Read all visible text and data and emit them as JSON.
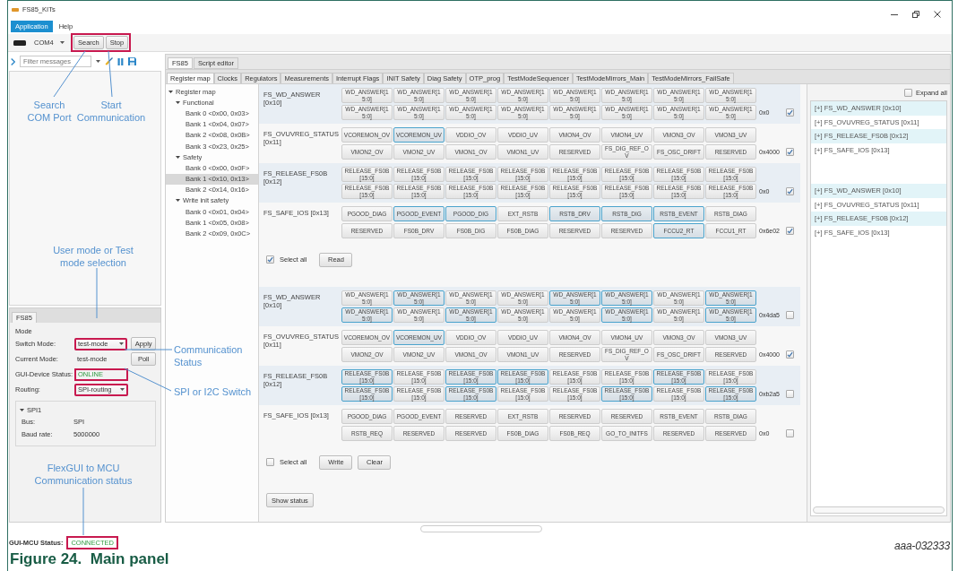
{
  "window": {
    "title": "FS85_KITs"
  },
  "menu": [
    {
      "label": "Application",
      "selected": true
    },
    {
      "label": "Help",
      "selected": false
    }
  ],
  "toolbar": {
    "port": "COM4",
    "buttons": [
      "Search",
      "Stop"
    ],
    "marked": true
  },
  "log_panel": {
    "filter_placeholder": "Filter messages"
  },
  "device_panel": {
    "tab": "FS85",
    "section": "Mode",
    "fields": [
      {
        "kind": "dropdown",
        "label": "Switch Mode:",
        "value": "test-mode",
        "button": "Apply",
        "marked": true
      },
      {
        "kind": "text",
        "label": "Current Mode:",
        "value": "test-mode",
        "button": "Poll",
        "marked": false
      },
      {
        "kind": "status",
        "label": "GUI-Device Status:",
        "value": "ONLINE",
        "marked": true
      },
      {
        "kind": "dropdown",
        "label": "Routing:",
        "value": "SPI-routing",
        "marked": true
      }
    ],
    "bus_group": {
      "title": "SPI1",
      "expanded": true,
      "rows": [
        {
          "label": "Bus:",
          "value": "SPI"
        },
        {
          "label": "Baud rate:",
          "value": "5000000"
        }
      ]
    }
  },
  "main_tabs": [
    {
      "label": "FS85",
      "selected": true
    },
    {
      "label": "Script editor",
      "selected": false
    }
  ],
  "sub_tabs": [
    {
      "label": "Register map",
      "selected": true
    },
    {
      "label": "Clocks",
      "selected": false
    },
    {
      "label": "Regulators",
      "selected": false
    },
    {
      "label": "Measurements",
      "selected": false
    },
    {
      "label": "Interrupt Flags",
      "selected": false
    },
    {
      "label": "INIT Safety",
      "selected": false
    },
    {
      "label": "Diag Safety",
      "selected": false
    },
    {
      "label": "OTP_prog",
      "selected": false
    },
    {
      "label": "TestModeSequencer",
      "selected": false
    },
    {
      "label": "TestModeMirrors_Main",
      "selected": false
    },
    {
      "label": "TestModeMirrors_FailSafe",
      "selected": false
    }
  ],
  "tree": {
    "label": "Register map",
    "expanded": true,
    "selected": false,
    "children": [
      {
        "label": "Functional",
        "expanded": true,
        "selected": false,
        "children": [
          {
            "label": "Bank 0 <0x00, 0x03>",
            "selected": false
          },
          {
            "label": "Bank 1 <0x04, 0x07>",
            "selected": false
          },
          {
            "label": "Bank 2 <0x08, 0x0B>",
            "selected": false
          },
          {
            "label": "Bank 3 <0x23, 0x25>",
            "selected": false
          }
        ]
      },
      {
        "label": "Safety",
        "expanded": true,
        "selected": false,
        "children": [
          {
            "label": "Bank 0 <0x00, 0x0F>",
            "selected": false
          },
          {
            "label": "Bank 1 <0x10, 0x13>",
            "selected": true
          },
          {
            "label": "Bank 2 <0x14, 0x16>",
            "selected": false
          }
        ]
      },
      {
        "label": "Write init safety",
        "expanded": true,
        "selected": false,
        "children": [
          {
            "label": "Bank 0 <0x01, 0x04>",
            "selected": false
          },
          {
            "label": "Bank 1 <0x05, 0x08>",
            "selected": false
          },
          {
            "label": "Bank 2 <0x09, 0x0C>",
            "selected": false
          }
        ]
      }
    ]
  },
  "read_panel": {
    "registers": [
      {
        "name": "FS_WD_ANSWER [0x10]",
        "value": "0x0",
        "checked": true,
        "bits": [
          [
            {
              "label": "WD_ANSWER[15:0]",
              "set": false
            },
            {
              "label": "WD_ANSWER[15:0]",
              "set": false
            },
            {
              "label": "WD_ANSWER[15:0]",
              "set": false
            },
            {
              "label": "WD_ANSWER[15:0]",
              "set": false
            },
            {
              "label": "WD_ANSWER[15:0]",
              "set": false
            },
            {
              "label": "WD_ANSWER[15:0]",
              "set": false
            },
            {
              "label": "WD_ANSWER[15:0]",
              "set": false
            },
            {
              "label": "WD_ANSWER[15:0]",
              "set": false
            }
          ],
          [
            {
              "label": "WD_ANSWER[15:0]",
              "set": false
            },
            {
              "label": "WD_ANSWER[15:0]",
              "set": false
            },
            {
              "label": "WD_ANSWER[15:0]",
              "set": false
            },
            {
              "label": "WD_ANSWER[15:0]",
              "set": false
            },
            {
              "label": "WD_ANSWER[15:0]",
              "set": false
            },
            {
              "label": "WD_ANSWER[15:0]",
              "set": false
            },
            {
              "label": "WD_ANSWER[15:0]",
              "set": false
            },
            {
              "label": "WD_ANSWER[15:0]",
              "set": false
            }
          ]
        ]
      },
      {
        "name": "FS_OVUVREG_STATUS [0x11]",
        "value": "0x4000",
        "checked": true,
        "bits": [
          [
            {
              "label": "VCOREMON_OV",
              "set": false
            },
            {
              "label": "VCOREMON_UV",
              "set": true
            },
            {
              "label": "VDDIO_OV",
              "set": false
            },
            {
              "label": "VDDIO_UV",
              "set": false
            },
            {
              "label": "VMON4_OV",
              "set": false
            },
            {
              "label": "VMON4_UV",
              "set": false
            },
            {
              "label": "VMON3_OV",
              "set": false
            },
            {
              "label": "VMON3_UV",
              "set": false
            }
          ],
          [
            {
              "label": "VMON2_OV",
              "set": false
            },
            {
              "label": "VMON2_UV",
              "set": false
            },
            {
              "label": "VMON1_OV",
              "set": false
            },
            {
              "label": "VMON1_UV",
              "set": false
            },
            {
              "label": "RESERVED",
              "set": false
            },
            {
              "label": "FS_DIG_REF_OV",
              "set": false
            },
            {
              "label": "FS_OSC_DRIFT",
              "set": false
            },
            {
              "label": "RESERVED",
              "set": false
            }
          ]
        ]
      },
      {
        "name": "FS_RELEASE_FS0B [0x12]",
        "value": "0x0",
        "checked": true,
        "bits": [
          [
            {
              "label": "RELEASE_FS0B[15:0]",
              "set": false
            },
            {
              "label": "RELEASE_FS0B[15:0]",
              "set": false
            },
            {
              "label": "RELEASE_FS0B[15:0]",
              "set": false
            },
            {
              "label": "RELEASE_FS0B[15:0]",
              "set": false
            },
            {
              "label": "RELEASE_FS0B[15:0]",
              "set": false
            },
            {
              "label": "RELEASE_FS0B[15:0]",
              "set": false
            },
            {
              "label": "RELEASE_FS0B[15:0]",
              "set": false
            },
            {
              "label": "RELEASE_FS0B[15:0]",
              "set": false
            }
          ],
          [
            {
              "label": "RELEASE_FS0B[15:0]",
              "set": false
            },
            {
              "label": "RELEASE_FS0B[15:0]",
              "set": false
            },
            {
              "label": "RELEASE_FS0B[15:0]",
              "set": false
            },
            {
              "label": "RELEASE_FS0B[15:0]",
              "set": false
            },
            {
              "label": "RELEASE_FS0B[15:0]",
              "set": false
            },
            {
              "label": "RELEASE_FS0B[15:0]",
              "set": false
            },
            {
              "label": "RELEASE_FS0B[15:0]",
              "set": false
            },
            {
              "label": "RELEASE_FS0B[15:0]",
              "set": false
            }
          ]
        ]
      },
      {
        "name": "FS_SAFE_IOS [0x13]",
        "value": "0x6e02",
        "checked": true,
        "bits": [
          [
            {
              "label": "PGOOD_DIAG",
              "set": false
            },
            {
              "label": "PGOOD_EVENT",
              "set": true
            },
            {
              "label": "PGOOD_DIG",
              "set": true
            },
            {
              "label": "EXT_RSTB",
              "set": false
            },
            {
              "label": "RSTB_DRV",
              "set": true
            },
            {
              "label": "RSTB_DIG",
              "set": true
            },
            {
              "label": "RSTB_EVENT",
              "set": true
            },
            {
              "label": "RSTB_DIAG",
              "set": false
            }
          ],
          [
            {
              "label": "RESERVED",
              "set": false
            },
            {
              "label": "FS0B_DRV",
              "set": false
            },
            {
              "label": "FS0B_DIG",
              "set": false
            },
            {
              "label": "FS0B_DIAG",
              "set": false
            },
            {
              "label": "RESERVED",
              "set": false
            },
            {
              "label": "RESERVED",
              "set": false
            },
            {
              "label": "FCCU2_RT",
              "set": true
            },
            {
              "label": "FCCU1_RT",
              "set": false
            }
          ]
        ]
      }
    ],
    "select_all": {
      "label": "Select all",
      "checked": true
    },
    "buttons": [
      "Read"
    ]
  },
  "write_panel": {
    "registers": [
      {
        "name": "FS_WD_ANSWER [0x10]",
        "value": "0x4da5",
        "checked": false,
        "bits": [
          [
            {
              "label": "WD_ANSWER[15:0]",
              "set": false
            },
            {
              "label": "WD_ANSWER[15:0]",
              "set": true
            },
            {
              "label": "WD_ANSWER[15:0]",
              "set": false
            },
            {
              "label": "WD_ANSWER[15:0]",
              "set": false
            },
            {
              "label": "WD_ANSWER[15:0]",
              "set": true
            },
            {
              "label": "WD_ANSWER[15:0]",
              "set": true
            },
            {
              "label": "WD_ANSWER[15:0]",
              "set": false
            },
            {
              "label": "WD_ANSWER[15:0]",
              "set": true
            }
          ],
          [
            {
              "label": "WD_ANSWER[15:0]",
              "set": true
            },
            {
              "label": "WD_ANSWER[15:0]",
              "set": false
            },
            {
              "label": "WD_ANSWER[15:0]",
              "set": true
            },
            {
              "label": "WD_ANSWER[15:0]",
              "set": false
            },
            {
              "label": "WD_ANSWER[15:0]",
              "set": false
            },
            {
              "label": "WD_ANSWER[15:0]",
              "set": true
            },
            {
              "label": "WD_ANSWER[15:0]",
              "set": false
            },
            {
              "label": "WD_ANSWER[15:0]",
              "set": true
            }
          ]
        ]
      },
      {
        "name": "FS_OVUVREG_STATUS [0x11]",
        "value": "0x4000",
        "checked": true,
        "bits": [
          [
            {
              "label": "VCOREMON_OV",
              "set": false
            },
            {
              "label": "VCOREMON_UV",
              "set": true
            },
            {
              "label": "VDDIO_OV",
              "set": false
            },
            {
              "label": "VDDIO_UV",
              "set": false
            },
            {
              "label": "VMON4_OV",
              "set": false
            },
            {
              "label": "VMON4_UV",
              "set": false
            },
            {
              "label": "VMON3_OV",
              "set": false
            },
            {
              "label": "VMON3_UV",
              "set": false
            }
          ],
          [
            {
              "label": "VMON2_OV",
              "set": false
            },
            {
              "label": "VMON2_UV",
              "set": false
            },
            {
              "label": "VMON1_OV",
              "set": false
            },
            {
              "label": "VMON1_UV",
              "set": false
            },
            {
              "label": "RESERVED",
              "set": false
            },
            {
              "label": "FS_DIG_REF_OV",
              "set": false
            },
            {
              "label": "FS_OSC_DRIFT",
              "set": false
            },
            {
              "label": "RESERVED",
              "set": false
            }
          ]
        ]
      },
      {
        "name": "FS_RELEASE_FS0B [0x12]",
        "value": "0xb2a5",
        "checked": false,
        "bits": [
          [
            {
              "label": "RELEASE_FS0B[15:0]",
              "set": true
            },
            {
              "label": "RELEASE_FS0B[15:0]",
              "set": false
            },
            {
              "label": "RELEASE_FS0B[15:0]",
              "set": true
            },
            {
              "label": "RELEASE_FS0B[15:0]",
              "set": true
            },
            {
              "label": "RELEASE_FS0B[15:0]",
              "set": false
            },
            {
              "label": "RELEASE_FS0B[15:0]",
              "set": false
            },
            {
              "label": "RELEASE_FS0B[15:0]",
              "set": true
            },
            {
              "label": "RELEASE_FS0B[15:0]",
              "set": false
            }
          ],
          [
            {
              "label": "RELEASE_FS0B[15:0]",
              "set": true
            },
            {
              "label": "RELEASE_FS0B[15:0]",
              "set": false
            },
            {
              "label": "RELEASE_FS0B[15:0]",
              "set": true
            },
            {
              "label": "RELEASE_FS0B[15:0]",
              "set": false
            },
            {
              "label": "RELEASE_FS0B[15:0]",
              "set": false
            },
            {
              "label": "RELEASE_FS0B[15:0]",
              "set": true
            },
            {
              "label": "RELEASE_FS0B[15:0]",
              "set": false
            },
            {
              "label": "RELEASE_FS0B[15:0]",
              "set": true
            }
          ]
        ]
      },
      {
        "name": "FS_SAFE_IOS [0x13]",
        "value": "0x0",
        "checked": false,
        "bits": [
          [
            {
              "label": "PGOOD_DIAG",
              "set": false
            },
            {
              "label": "PGOOD_EVENT",
              "set": false
            },
            {
              "label": "RESERVED",
              "set": false
            },
            {
              "label": "EXT_RSTB",
              "set": false
            },
            {
              "label": "RESERVED",
              "set": false
            },
            {
              "label": "RESERVED",
              "set": false
            },
            {
              "label": "RSTB_EVENT",
              "set": false
            },
            {
              "label": "RSTB_DIAG",
              "set": false
            }
          ],
          [
            {
              "label": "RSTB_REQ",
              "set": false
            },
            {
              "label": "RESERVED",
              "set": false
            },
            {
              "label": "RESERVED",
              "set": false
            },
            {
              "label": "FS0B_DIAG",
              "set": false
            },
            {
              "label": "FS0B_REQ",
              "set": false
            },
            {
              "label": "GO_TO_INITFS",
              "set": false
            },
            {
              "label": "RESERVED",
              "set": false
            },
            {
              "label": "RESERVED",
              "set": false
            }
          ]
        ]
      }
    ],
    "select_all": {
      "label": "Select all",
      "checked": false
    },
    "buttons": [
      "Write",
      "Clear"
    ]
  },
  "show_status_button": "Show status",
  "summary_panel": {
    "expand_all": {
      "label": "Expand all",
      "checked": false
    },
    "lists": [
      [
        "[+] FS_WD_ANSWER [0x10]",
        "[+] FS_OVUVREG_STATUS [0x11]",
        "[+] FS_RELEASE_FS0B [0x12]",
        "[+] FS_SAFE_IOS [0x13]"
      ],
      [
        "[+] FS_WD_ANSWER [0x10]",
        "[+] FS_OVUVREG_STATUS [0x11]",
        "[+] FS_RELEASE_FS0B [0x12]",
        "[+] FS_SAFE_IOS [0x13]"
      ]
    ]
  },
  "status_bar": {
    "label": "GUI-MCU Status:",
    "value": "CONNECTED",
    "marked": true
  },
  "annotations": [
    "Search COM Port",
    "Start Communication",
    "User mode or Test mode selection",
    "Communication Status",
    "SPI or I2C Switch",
    "FlexGUI to MCU Communication status"
  ],
  "figure": {
    "id": "aaa-032333",
    "caption": "Figure 24.  Main panel"
  }
}
